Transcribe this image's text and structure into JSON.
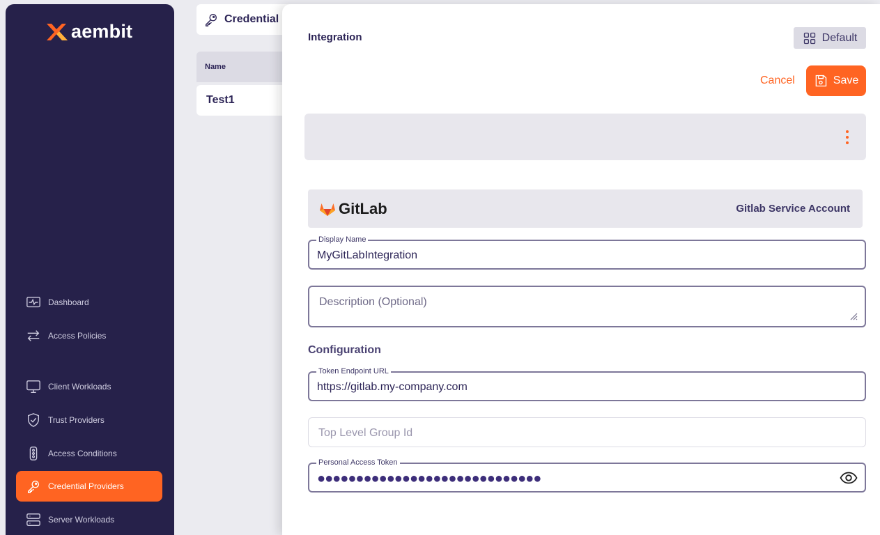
{
  "sidebar": {
    "brand": "aembit",
    "items": [
      {
        "label": "Dashboard",
        "icon": "pulse-monitor-icon"
      },
      {
        "label": "Access Policies",
        "icon": "arrows-exchange-icon"
      },
      {
        "label": "Client Workloads",
        "icon": "monitor-icon"
      },
      {
        "label": "Trust Providers",
        "icon": "shield-check-icon"
      },
      {
        "label": "Access Conditions",
        "icon": "traffic-light-icon"
      },
      {
        "label": "Credential Providers",
        "icon": "key-icon",
        "active": true
      },
      {
        "label": "Server Workloads",
        "icon": "server-icon"
      }
    ]
  },
  "background": {
    "breadcrumb": "Credential",
    "column_name": "Name",
    "row_1": "Test1"
  },
  "drawer": {
    "title": "Integration",
    "view_mode": "Default",
    "cancel_label": "Cancel",
    "save_label": "Save",
    "provider": {
      "logo_text": "GitLab",
      "type": "Gitlab Service Account"
    },
    "display_name": {
      "label": "Display Name",
      "value": "MyGitLabIntegration"
    },
    "description": {
      "placeholder": "Description (Optional)"
    },
    "configuration_title": "Configuration",
    "token_endpoint": {
      "label": "Token Endpoint URL",
      "value": "https://gitlab.my-company.com"
    },
    "top_level_group": {
      "placeholder": "Top Level Group Id"
    },
    "personal_access_token": {
      "label": "Personal Access Token",
      "masked_value": "●●●●●●●●●●●●●●●●●●●●●●●●●●●●●"
    }
  },
  "colors": {
    "accent": "#ff6422",
    "sidebar": "#26214a",
    "text": "#2c2456"
  }
}
